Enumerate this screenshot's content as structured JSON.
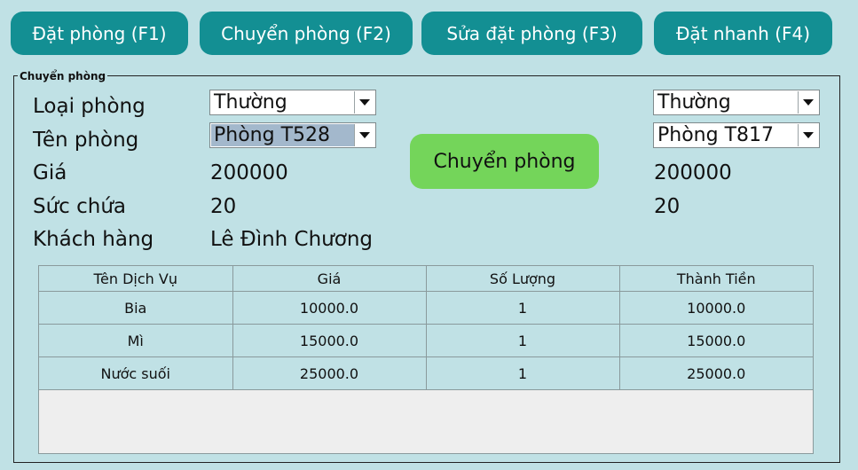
{
  "toolbar": {
    "buttons": [
      {
        "label": "Đặt phòng (F1)"
      },
      {
        "label": "Chuyển phòng (F2)"
      },
      {
        "label": "Sửa đặt phòng (F3)"
      },
      {
        "label": "Đặt nhanh (F4)"
      }
    ]
  },
  "panel": {
    "title": "Chuyển phòng",
    "labels": {
      "room_type": "Loại phòng",
      "room_name": "Tên phòng",
      "price": "Giá",
      "capacity": "Sức chứa",
      "customer": "Khách hàng"
    },
    "source": {
      "room_type": "Thường",
      "room_name": "Phòng T528",
      "price": "200000",
      "capacity": "20",
      "customer": "Lê Đình Chương"
    },
    "target": {
      "room_type": "Thường",
      "room_name": "Phòng T817",
      "price": "200000",
      "capacity": "20"
    },
    "move_button": "Chuyển phòng"
  },
  "services_table": {
    "headers": [
      "Tên Dịch Vụ",
      "Giá",
      "Số Lượng",
      "Thành Tiền"
    ],
    "rows": [
      [
        "Bia",
        "10000.0",
        "1",
        "10000.0"
      ],
      [
        "Mì",
        "15000.0",
        "1",
        "15000.0"
      ],
      [
        "Nước suối",
        "25000.0",
        "1",
        "25000.0"
      ]
    ]
  },
  "icons": {
    "combo_arrow": "chevron-down-icon"
  },
  "colors": {
    "background": "#c0e1e5",
    "toolbar_button": "#138f93",
    "move_button": "#74d55a",
    "selection": "#a3b8cc"
  }
}
